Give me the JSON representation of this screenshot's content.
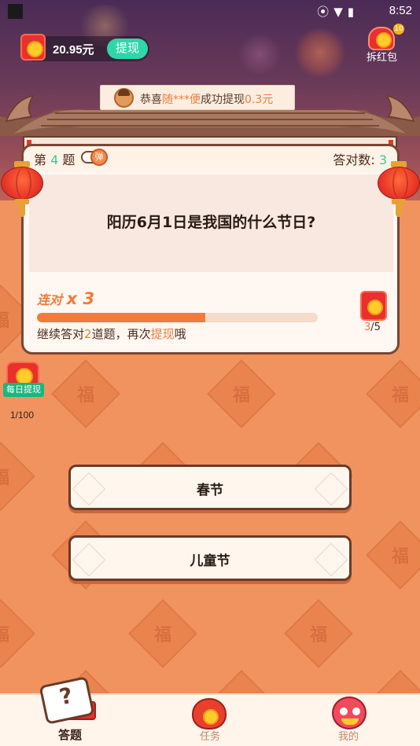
{
  "status_bar": {
    "time": "8:52",
    "icons": [
      "location-icon",
      "wifi-icon",
      "battery-icon"
    ]
  },
  "balance": {
    "amount": "20.95元",
    "withdraw_label": "提现"
  },
  "red_packet": {
    "label": "拆红包",
    "badge": "10"
  },
  "notice": {
    "prefix": "恭喜",
    "user": "随***便",
    "middle": "成功提现",
    "amount": "0.3元"
  },
  "question": {
    "number_prefix": "第",
    "number": "4",
    "number_suffix": "题",
    "toggle_label": "弹",
    "correct_label": "答对数:",
    "correct_count": "3",
    "text": "阳历6月1日是我国的什么节日?"
  },
  "streak": {
    "label": "连对",
    "multiplier": "x 3",
    "progress": 0.6,
    "tip_prefix": "继续答对",
    "tip_count": "2",
    "tip_middle": "道题，再次",
    "tip_highlight": "提现",
    "tip_suffix": "哦",
    "packet_current": "3",
    "packet_total": "/5"
  },
  "daily_withdraw": {
    "label": "每日提现",
    "count": "1/100"
  },
  "answers": [
    "春节",
    "儿童节"
  ],
  "nav": {
    "items": [
      {
        "label": "答题",
        "icon": "quiz-icon",
        "active": true
      },
      {
        "label": "任务",
        "icon": "money-bag-icon",
        "active": false
      },
      {
        "label": "我的",
        "icon": "lion-dance-icon",
        "active": false
      }
    ]
  },
  "colors": {
    "accent": "#f07b3c",
    "green": "#3cc8a0",
    "withdraw_green": "#2fd6a9",
    "red": "#e8302c",
    "background": "#f0935f"
  }
}
